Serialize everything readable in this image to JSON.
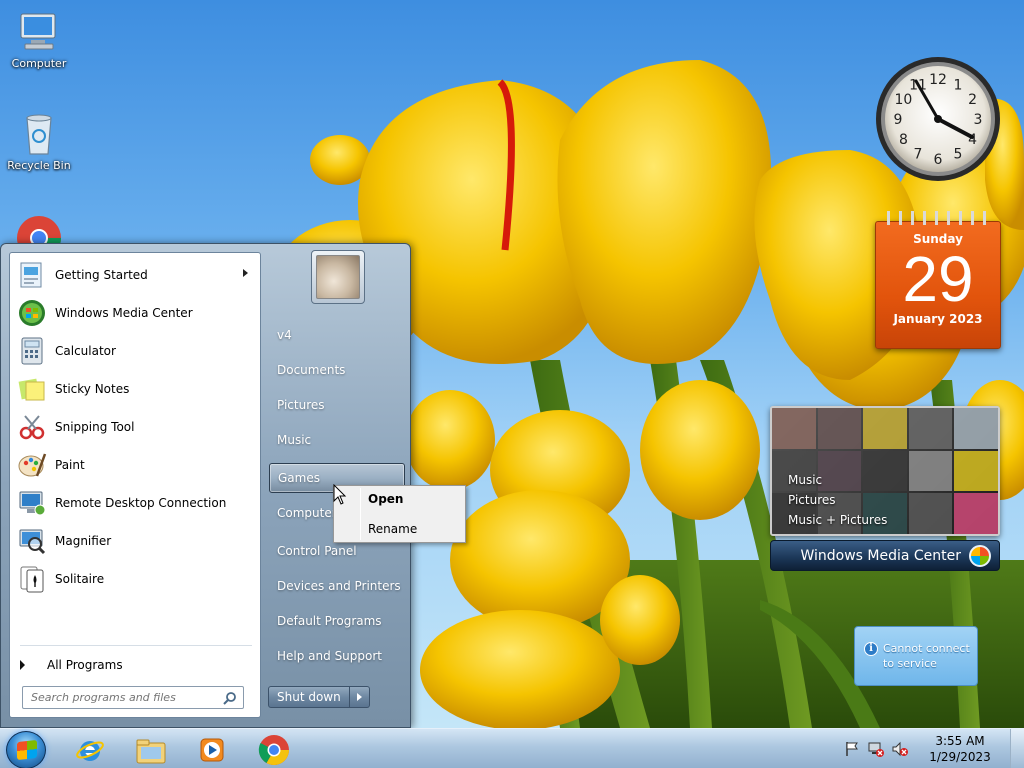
{
  "desktop": {
    "icons": [
      {
        "label": "Computer"
      },
      {
        "label": "Recycle Bin"
      }
    ]
  },
  "gadgets": {
    "calendar": {
      "weekday": "Sunday",
      "day": "29",
      "month_year": "January 2023"
    },
    "clock_numerals": [
      "12",
      "1",
      "2",
      "3",
      "4",
      "5",
      "6",
      "7",
      "8",
      "9",
      "10",
      "11"
    ],
    "media_center": {
      "menu": [
        "Music",
        "Pictures",
        "Music + Pictures"
      ],
      "title": "Windows Media Center"
    },
    "service_notice": {
      "line1": "Cannot connect",
      "line2": "to service",
      "info_glyph": "i"
    }
  },
  "start_menu": {
    "programs": [
      {
        "label": "Getting Started",
        "icon": "getting-started-icon",
        "has_submenu": true
      },
      {
        "label": "Windows Media Center",
        "icon": "media-center-icon"
      },
      {
        "label": "Calculator",
        "icon": "calculator-icon"
      },
      {
        "label": "Sticky Notes",
        "icon": "sticky-notes-icon"
      },
      {
        "label": "Snipping Tool",
        "icon": "snipping-tool-icon"
      },
      {
        "label": "Paint",
        "icon": "paint-icon"
      },
      {
        "label": "Remote Desktop Connection",
        "icon": "remote-desktop-icon"
      },
      {
        "label": "Magnifier",
        "icon": "magnifier-icon"
      },
      {
        "label": "Solitaire",
        "icon": "solitaire-icon"
      }
    ],
    "all_programs": "All Programs",
    "search_placeholder": "Search programs and files",
    "right_items": [
      {
        "label": "v4"
      },
      {
        "label": "Documents"
      },
      {
        "label": "Pictures"
      },
      {
        "label": "Music"
      },
      {
        "label": "Games",
        "highlighted": true
      },
      {
        "label": "Computer"
      },
      {
        "label": "Control Panel"
      },
      {
        "label": "Devices and Printers"
      },
      {
        "label": "Default Programs"
      },
      {
        "label": "Help and Support"
      }
    ],
    "shutdown_label": "Shut down"
  },
  "context_menu": {
    "items": [
      {
        "label": "Open",
        "bold": true
      },
      {
        "label": "Rename"
      }
    ]
  },
  "taskbar": {
    "apps": [
      "internet-explorer-icon",
      "windows-explorer-icon",
      "media-player-icon",
      "chrome-icon"
    ],
    "time": "3:55 AM",
    "date": "1/29/2023"
  },
  "colors": {
    "calendar_orange": "#e2540c",
    "start_menu_blue": "#8ca4bb",
    "tulip_yellow": "#f5c400"
  }
}
